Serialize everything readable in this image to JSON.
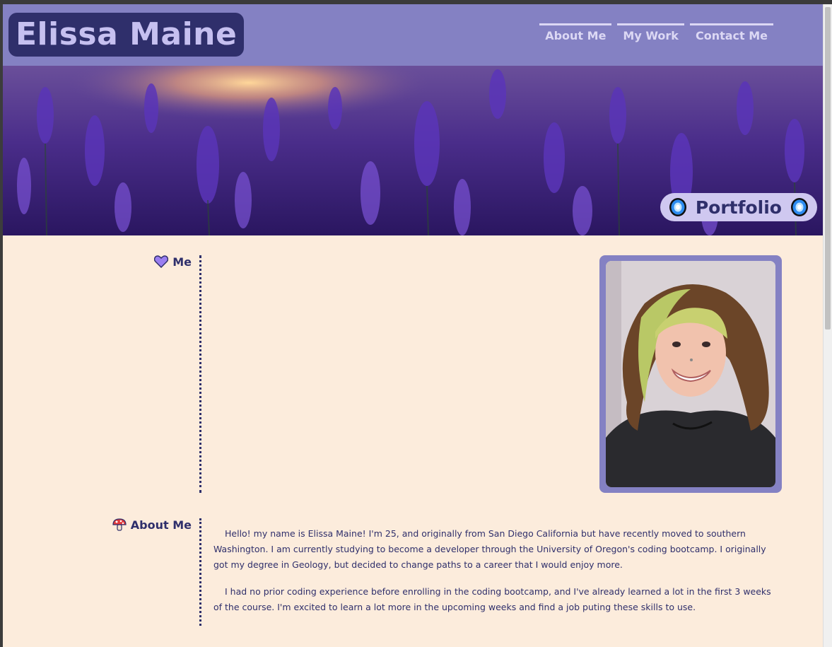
{
  "header": {
    "title": "Elissa Maine",
    "nav": [
      "About Me",
      "My Work",
      "Contact Me"
    ]
  },
  "hero": {
    "badge": "Portfolio",
    "badge_icon": "portal-icon"
  },
  "sections": {
    "me": {
      "label": "Me",
      "icon": "purple-heart-icon"
    },
    "about": {
      "label": "About Me",
      "icon": "mushroom-icon",
      "paragraphs": [
        "Hello! my name is Elissa Maine! I'm 25, and originally from San Diego California but have recently moved to southern Washington. I am currently studying to become a developer through the University of Oregon's coding bootcamp. I originally got my degree in Geology, but decided to change paths to a career that I would enjoy more.",
        "I had no prior coding experience before enrolling in the coding bootcamp, and I've already learned a lot in the first 3 weeks of the course. I'm excited to learn a lot more in the upcoming weeks and find a job puting these skills to use."
      ]
    }
  },
  "colors": {
    "header_bg": "#8481c3",
    "brand_bg": "#2f2f6b",
    "page_bg": "#fcecdc",
    "text": "#2f2f6b"
  }
}
